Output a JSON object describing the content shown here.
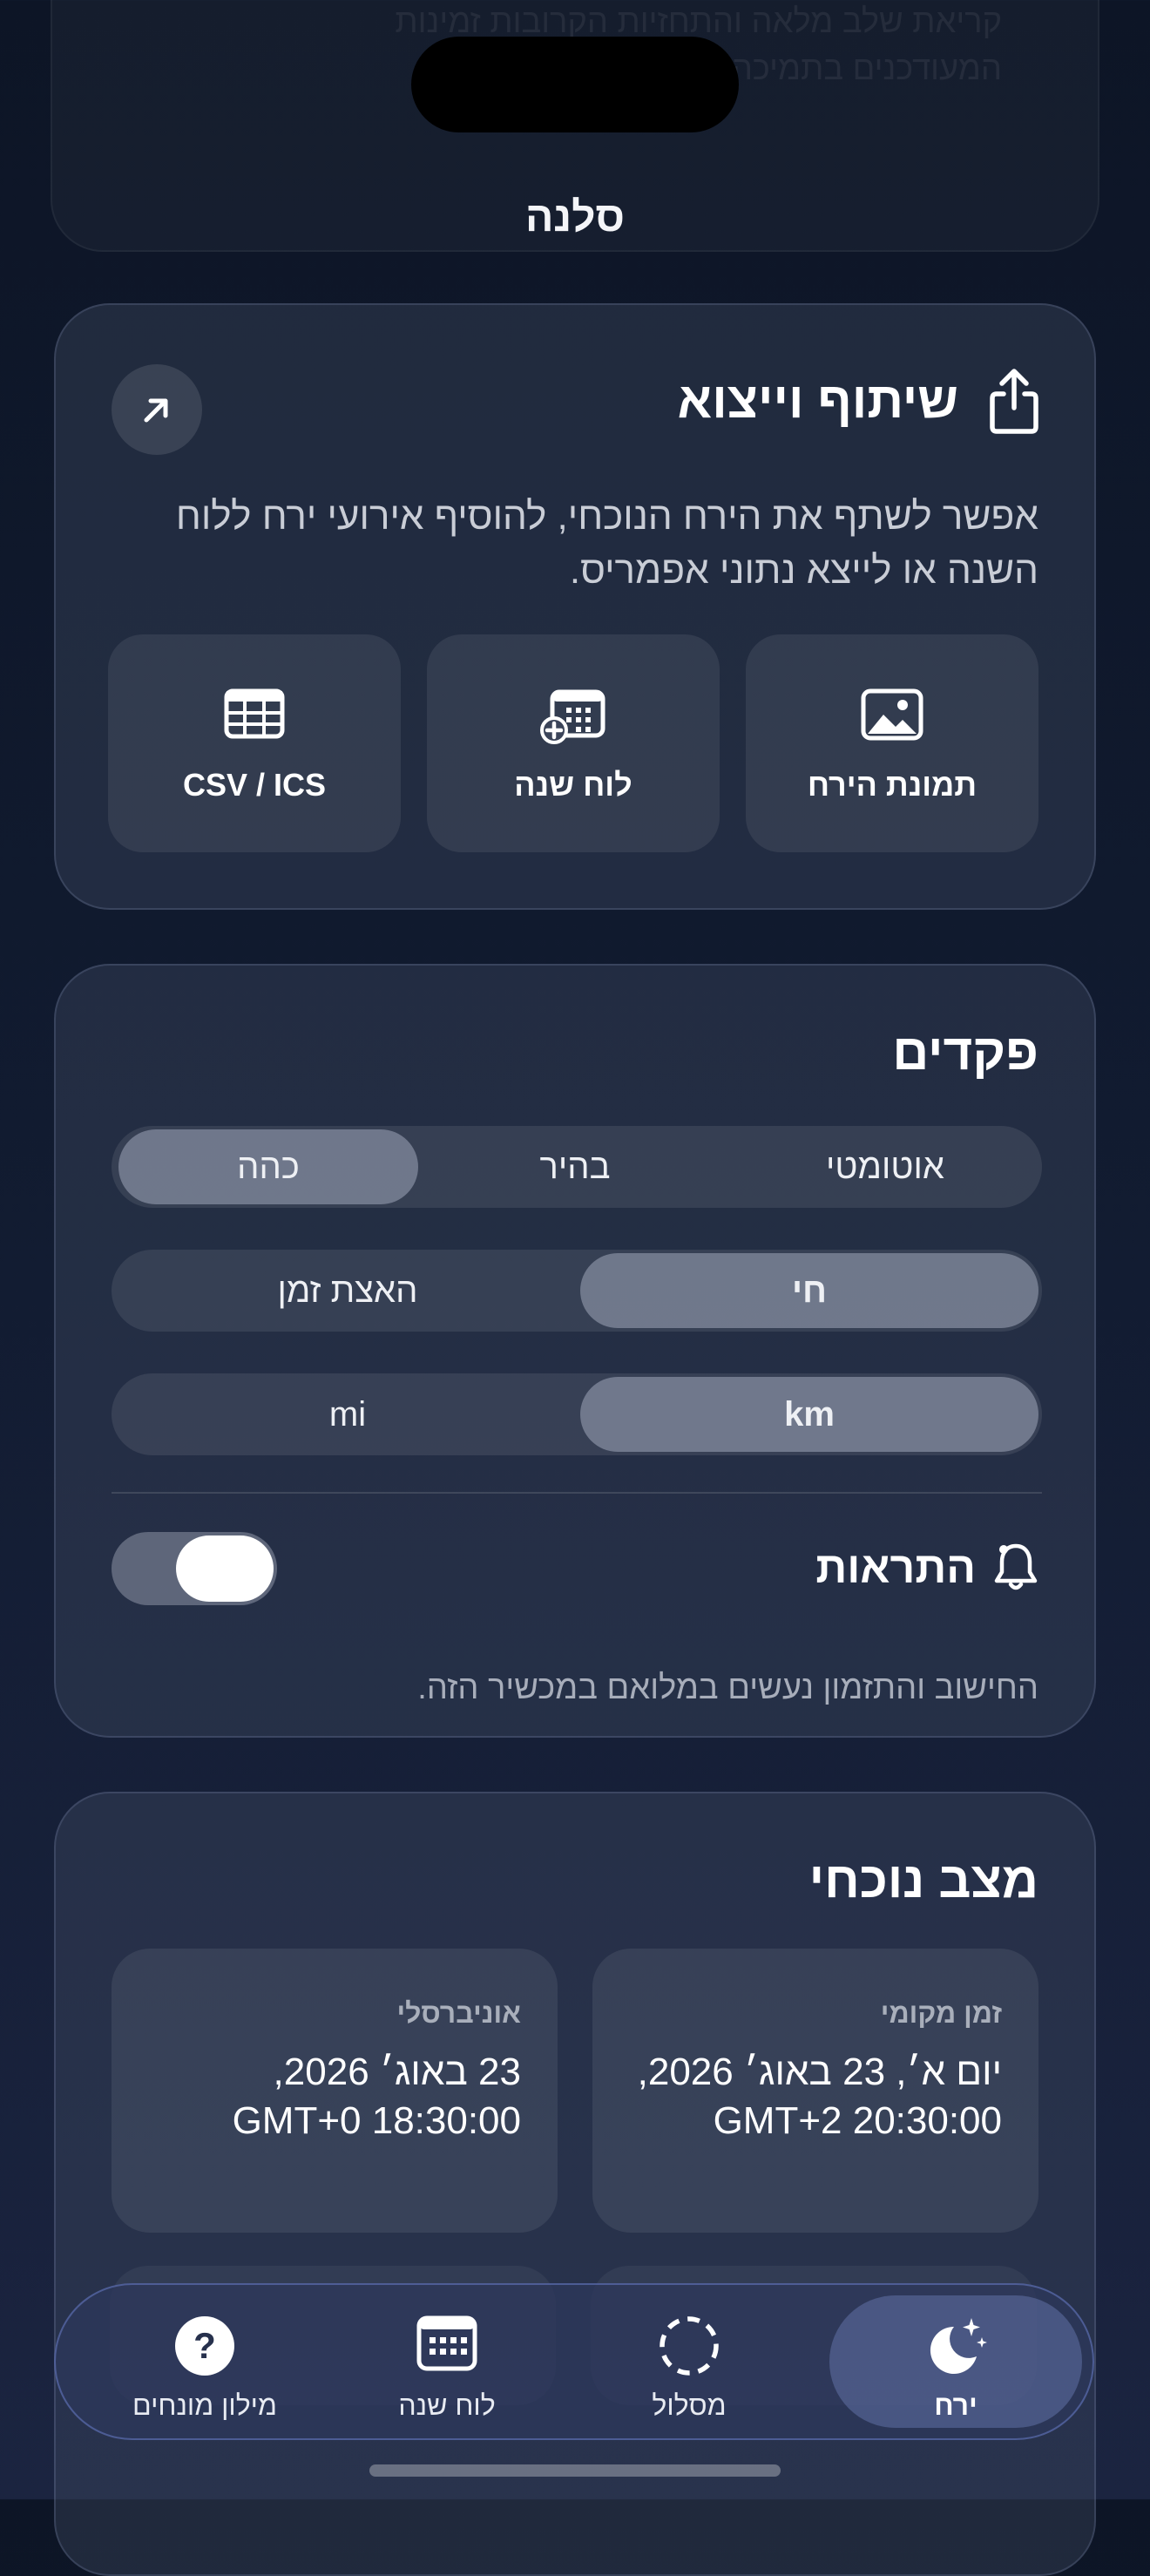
{
  "header": {
    "app_title": "סלנה"
  },
  "share_card": {
    "title": "שיתוף וייצוא",
    "description": "אפשר לשתף את הירח הנוכחי, להוסיף אירועי ירח ללוח השנה או לייצא נתוני אפמריס.",
    "actions": [
      {
        "label": "תמונת הירח",
        "icon": "image-icon"
      },
      {
        "label": "לוח שנה",
        "icon": "calendar-add-icon"
      },
      {
        "label": "CSV / ICS",
        "icon": "table-icon"
      }
    ]
  },
  "controls_card": {
    "title": "פקדים",
    "theme": {
      "options": [
        "אוטומטי",
        "בהיר",
        "כהה"
      ],
      "selected": "כהה"
    },
    "mode": {
      "options": [
        "חי",
        "האצת זמן"
      ],
      "selected": "חי"
    },
    "units": {
      "options": [
        "km",
        "mi"
      ],
      "selected": "km"
    },
    "notifications": {
      "label": "התראות",
      "enabled": true
    },
    "note": "החישוב והתזמון נעשים במלואם במכשיר הזה."
  },
  "status_card": {
    "title": "מצב נוכחי",
    "local": {
      "label": "זמן מקומי",
      "value": "יום א׳, 23 באוג׳ 2026, 20:30:00 GMT+2"
    },
    "universal": {
      "label": "אוניברסלי",
      "value": "23 באוג׳ 2026, 18:30:00 GMT+0"
    }
  },
  "tabbar": {
    "tabs": [
      {
        "label": "ירח",
        "active": true
      },
      {
        "label": "מסלול",
        "active": false
      },
      {
        "label": "לוח שנה",
        "active": false
      },
      {
        "label": "מילון מונחים",
        "active": false
      }
    ]
  },
  "colors": {
    "background": "#0d1526",
    "card": "#3a4358",
    "selected_segment": "#7a8296"
  }
}
